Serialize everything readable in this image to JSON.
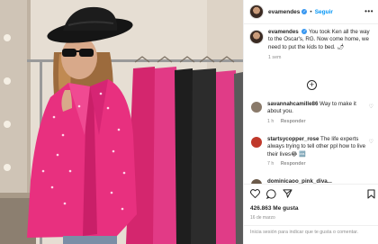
{
  "post": {
    "username": "evamendes",
    "follow_label": "Seguir",
    "separator": "•",
    "more_glyph": "•••",
    "caption_user": "evamendes",
    "caption_text": "You took Ken all the way to the Oscar's, RG. Now come home, we need to put the kids to bed. 🌶",
    "caption_time": "1 sem",
    "load_more_glyph": "+"
  },
  "comments": [
    {
      "user": "savannahcamille86",
      "text": "Way to make it about you.",
      "time": "1 h",
      "reply": "Responder",
      "avatar_color": "#8a7a6a"
    },
    {
      "user": "startsycopper_rose",
      "text": "The life experts always trying to tell other ppl how to live their lives😂 🆒",
      "time": "7 h",
      "reply": "Responder",
      "avatar_color": "#c0392b"
    }
  ],
  "partial_comment": {
    "text": "dominicaoo_pink_diva..."
  },
  "actions": {
    "likes": "426.863 Me gusta",
    "date": "16 de marzo",
    "comment_placeholder": "Inicia sesión para indicar que te gusta o comentar."
  },
  "icons": {
    "like": "heart-icon",
    "comment": "comment-icon",
    "share": "share-icon",
    "save": "bookmark-icon",
    "more": "more-icon",
    "load_more": "plus-circle-icon"
  },
  "colors": {
    "accent": "#0095f6",
    "blazer": "#e8307f",
    "muted_text": "#8e8e8e"
  }
}
